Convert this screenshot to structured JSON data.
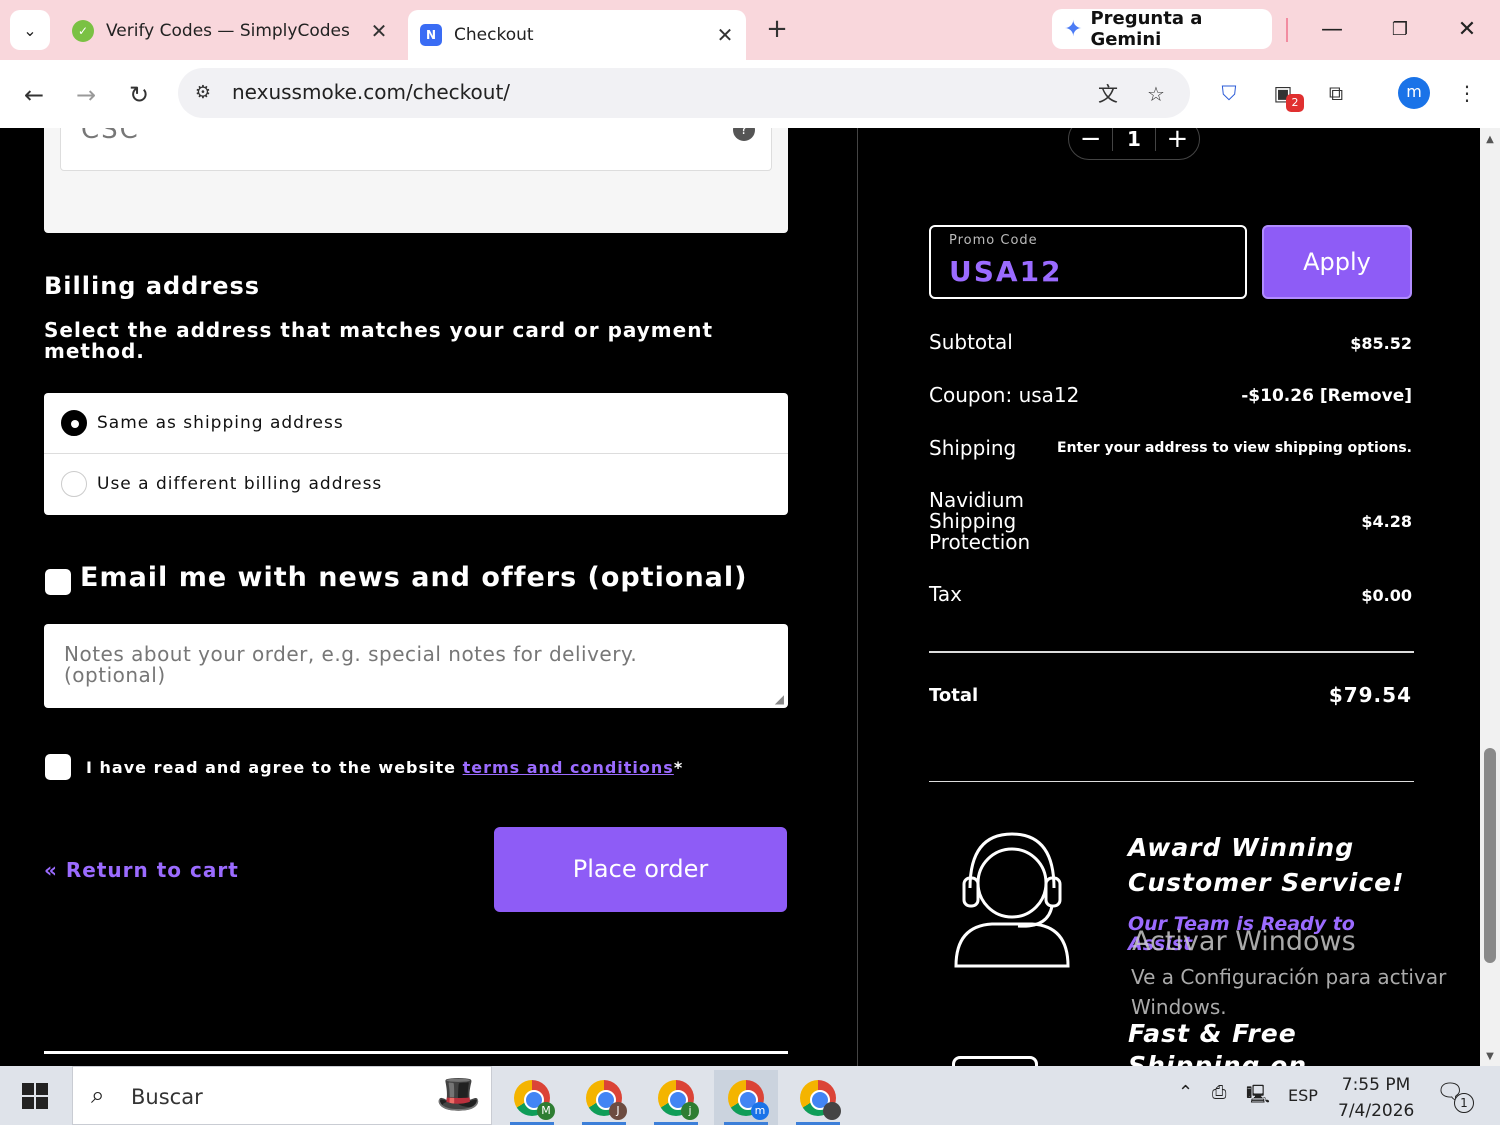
{
  "browser": {
    "tabs": [
      {
        "title": "Verify Codes — SimplyCodes",
        "active": false
      },
      {
        "title": "Checkout",
        "active": true
      }
    ],
    "gemini_label": "Pregunta a Gemini",
    "url": "nexussmoke.com/checkout/",
    "extension_badge": "2",
    "profile_initial": "m"
  },
  "checkout": {
    "csc_label": "CSC",
    "csc_help": "?",
    "billing_heading": "Billing address",
    "billing_sub": "Select the address that matches your card or payment method.",
    "billing_options": [
      {
        "label": "Same as shipping address",
        "selected": true
      },
      {
        "label": "Use a different billing address",
        "selected": false
      }
    ],
    "email_optin": "Email me with news and offers (optional)",
    "notes_placeholder": "Notes about your order, e.g. special notes for delivery. (optional)",
    "terms_prefix": "I have read and agree to the website ",
    "terms_link": "terms and conditions",
    "terms_suffix": "*",
    "return_link": "« Return to cart",
    "place_order": "Place order"
  },
  "summary": {
    "qty_minus": "−",
    "qty_value": "1",
    "qty_plus": "+",
    "promo_label": "Promo Code",
    "promo_value": "USA12",
    "apply_label": "Apply",
    "rows": [
      {
        "key": "Subtotal",
        "value": "$85.52"
      },
      {
        "key": "Coupon: usa12",
        "value": "-$10.26",
        "remove": "[Remove]"
      },
      {
        "key": "Shipping",
        "value": "Enter your address to view shipping options."
      },
      {
        "key": "Navidium Shipping Protection",
        "value": "$4.28"
      },
      {
        "key": "Tax",
        "value": "$0.00"
      }
    ],
    "total_label": "Total",
    "total_value": "$79.54"
  },
  "features": {
    "award_title": "Award Winning Customer Service!",
    "award_sub": "Our Team is Ready to Assist",
    "fast_title": "Fast & Free Shipping on"
  },
  "watermark": {
    "title": "Activar Windows",
    "sub": "Ve a Configuración para activar Windows."
  },
  "taskbar": {
    "search_label": "Buscar",
    "apps": [
      {
        "badge": "M",
        "badge_color": "#2e7d32"
      },
      {
        "badge": "J",
        "badge_color": "#6d4c41"
      },
      {
        "badge": "j",
        "badge_color": "#2e7d32"
      },
      {
        "badge": "m",
        "badge_color": "#1a73e8"
      },
      {
        "badge": "",
        "badge_color": "#444444"
      }
    ],
    "lang": "ESP",
    "time": "7:55 PM",
    "date": "7/4/2026",
    "notification_count": "1"
  },
  "colors": {
    "accent": "#8e5cf6",
    "link": "#9b6bff",
    "tabbar": "#f9d7dc"
  }
}
